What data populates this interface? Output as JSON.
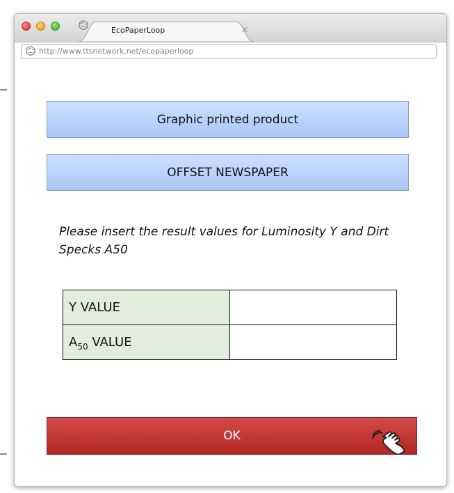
{
  "browser": {
    "tab_title": "EcoPaperLoop",
    "tab_close": "×",
    "url": "http://www.ttsnetwork.net/ecopaperloop"
  },
  "page": {
    "product_label": "Graphic printed product",
    "category_label": "OFFSET NEWSPAPER",
    "instruction": "Please insert the result values for Luminosity Y and Dirt Specks A50",
    "table": {
      "rows": [
        {
          "label": "Y VALUE",
          "value": ""
        },
        {
          "label_prefix": "A",
          "label_sub": "50",
          "label_suffix": " VALUE",
          "value": ""
        }
      ]
    },
    "ok_label": "OK"
  },
  "icons": [
    "globe-icon",
    "close-icon",
    "hand-pointer-icon"
  ],
  "colors": {
    "info_bar": "#b9d2fb",
    "label_cell": "#e2eedb",
    "ok_button": "#c23634"
  }
}
